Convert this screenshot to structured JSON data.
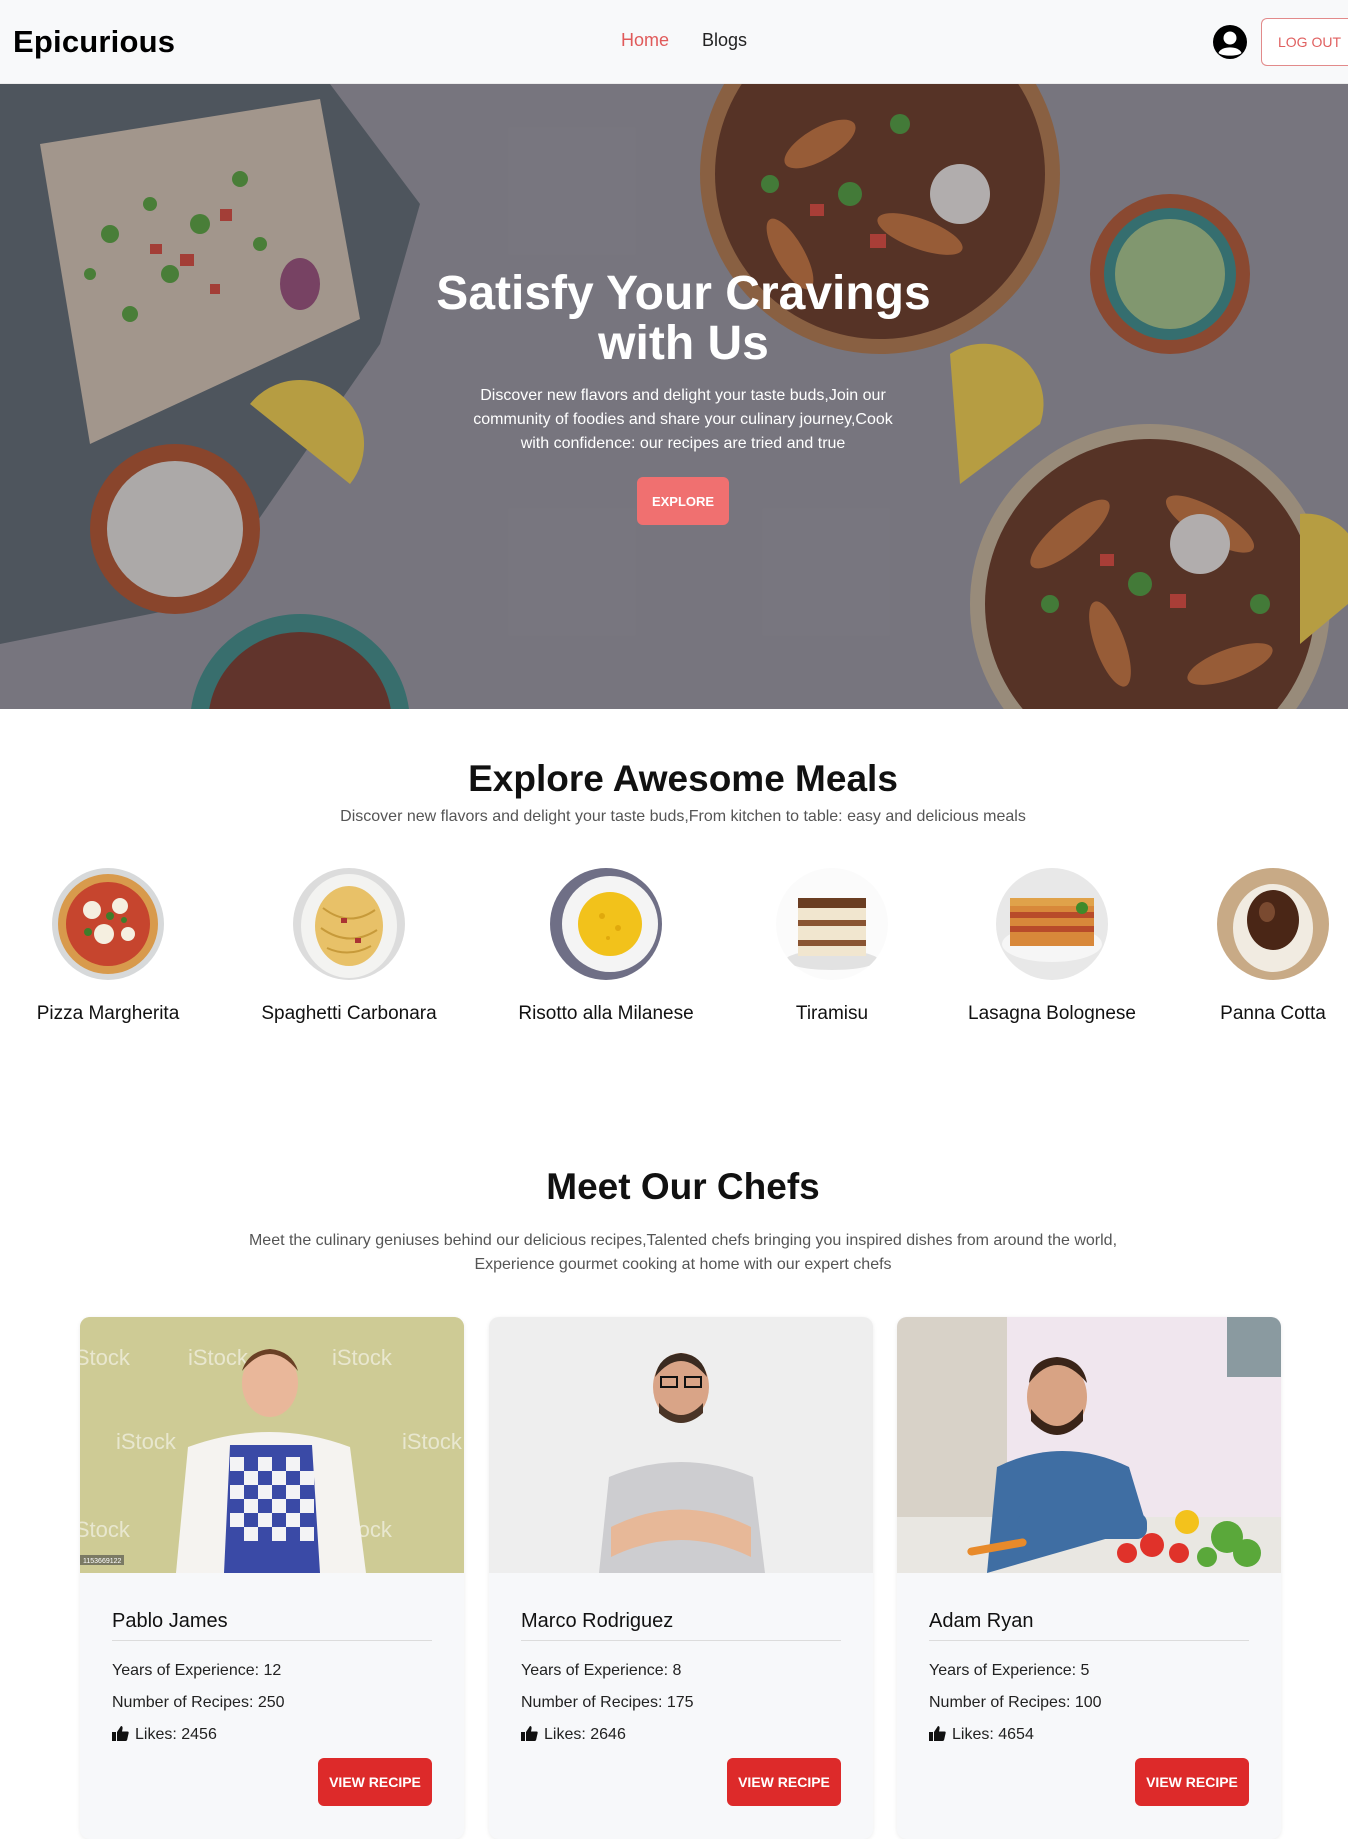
{
  "nav": {
    "brand": "Epicurious",
    "links": [
      {
        "label": "Home",
        "active": true
      },
      {
        "label": "Blogs",
        "active": false
      }
    ],
    "avatar_icon": "user-circle-icon",
    "logout_label": "LOG OUT"
  },
  "hero": {
    "title": "Satisfy Your Cravings with Us",
    "subtitle": "Discover new flavors and delight your taste buds,Join our community of foodies and share your culinary journey,Cook with confidence: our recipes are tried and true",
    "button_label": "EXPLORE"
  },
  "meals": {
    "title": "Explore Awesome Meals",
    "subtitle": "Discover new flavors and delight your taste buds,From kitchen to table: easy and delicious meals",
    "items": [
      {
        "name": "Pizza Margherita"
      },
      {
        "name": "Spaghetti Carbonara"
      },
      {
        "name": "Risotto alla Milanese"
      },
      {
        "name": "Tiramisu"
      },
      {
        "name": "Lasagna Bolognese"
      },
      {
        "name": "Panna Cotta"
      }
    ]
  },
  "chefs": {
    "title": "Meet Our Chefs",
    "subtitle": "Meet the culinary geniuses behind our delicious recipes,Talented chefs bringing you inspired dishes from around the world, Experience gourmet cooking at home with our expert chefs",
    "items": [
      {
        "name": "Pablo James",
        "experience": "Years of Experience: 12",
        "recipes": "Number of Recipes: 250",
        "likes": "Likes: 2456",
        "button": "VIEW RECIPE",
        "watermark": "iStock",
        "photo_id": "1153669122"
      },
      {
        "name": "Marco Rodriguez",
        "experience": "Years of Experience: 8",
        "recipes": "Number of Recipes: 175",
        "likes": "Likes: 2646",
        "button": "VIEW RECIPE"
      },
      {
        "name": "Adam Ryan",
        "experience": "Years of Experience: 5",
        "recipes": "Number of Recipes: 100",
        "likes": "Likes: 4654",
        "button": "VIEW RECIPE"
      }
    ],
    "like_icon": "thumbs-up-icon"
  },
  "colors": {
    "accent": "#e05a5a",
    "explore_button": "#f07070",
    "view_button": "#dd2a2a",
    "nav_bg": "#f8f9fa"
  }
}
